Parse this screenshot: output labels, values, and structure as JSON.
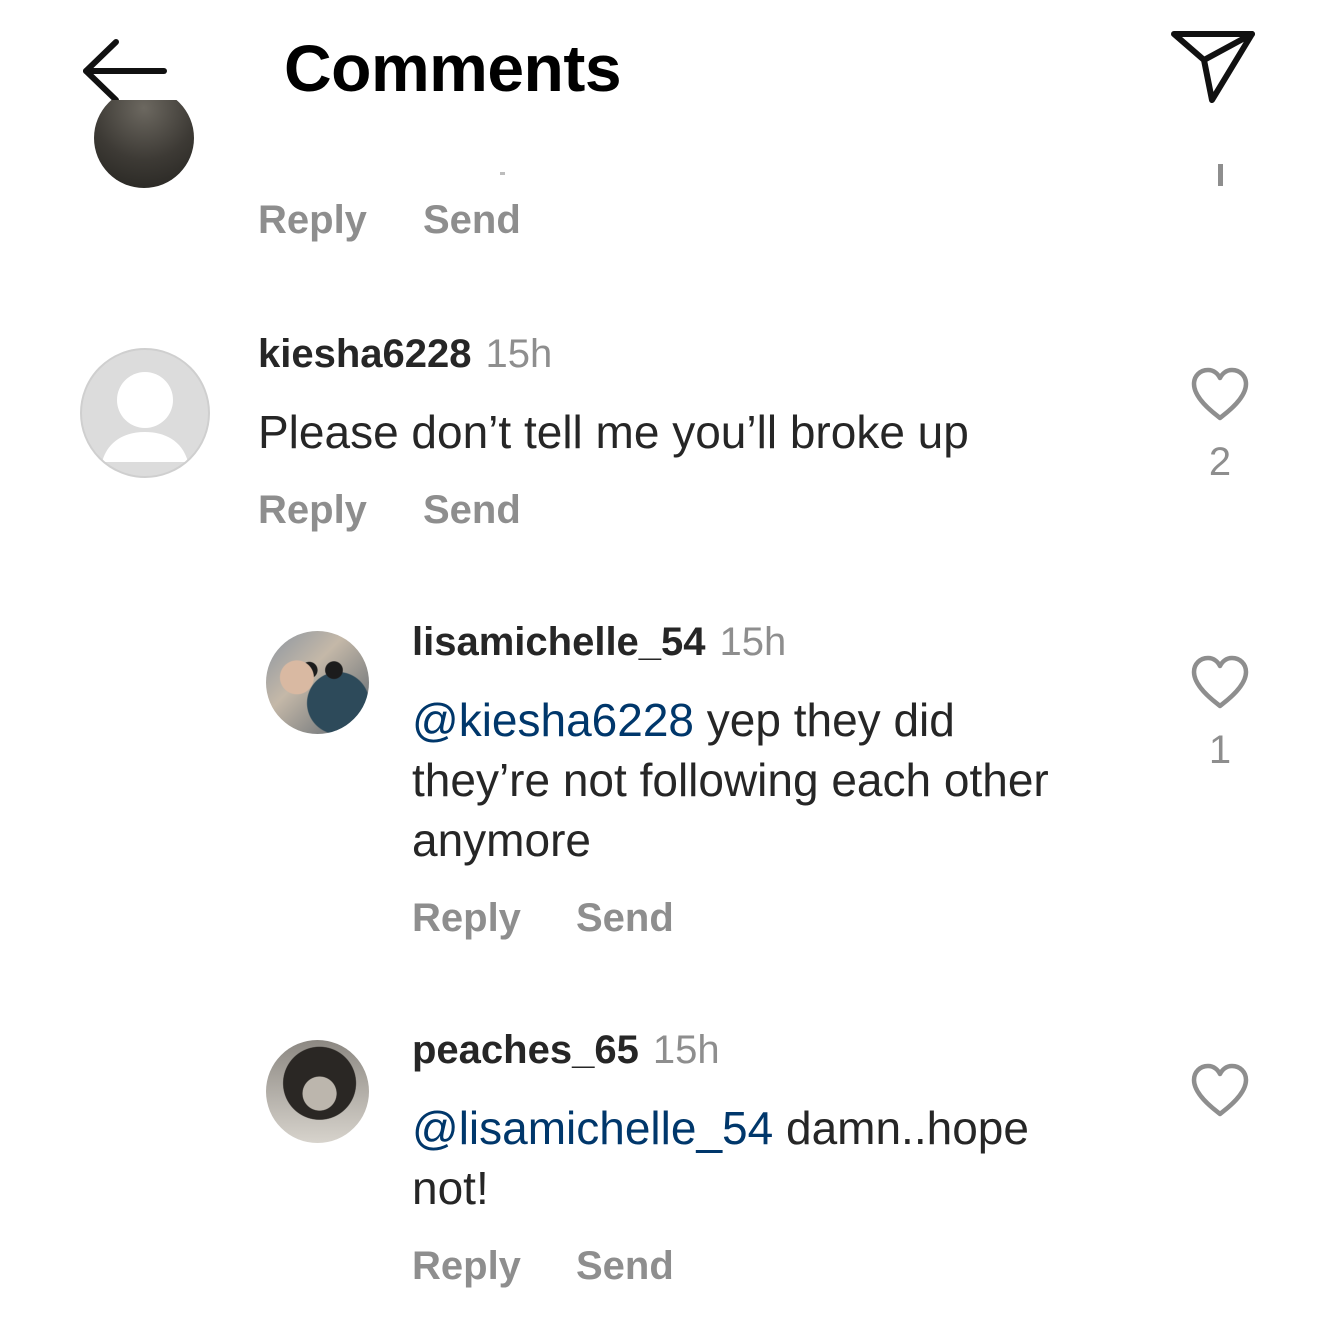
{
  "header": {
    "title": "Comments",
    "back_icon": "arrow-left-icon",
    "share_icon": "paper-plane-icon"
  },
  "colors": {
    "text_primary": "#262626",
    "text_secondary": "#8e8e8e",
    "mention": "#00376b"
  },
  "actions": {
    "reply_label": "Reply",
    "send_label": "Send"
  },
  "comments": [
    {
      "username": "kiesha6228",
      "time": "15h",
      "text": "Please don’t tell me you’ll broke up",
      "likes": "2"
    }
  ],
  "replies": [
    {
      "username": "lisamichelle_54",
      "time": "15h",
      "mention": "@kiesha6228",
      "text_line1": " yep they did",
      "text_line2": "they’re not following each other",
      "text_line3": "anymore",
      "likes": "1"
    },
    {
      "username": "peaches_65",
      "time": "15h",
      "mention": "@lisamichelle_54",
      "text_line1": " damn..hope",
      "text_line2": "not!"
    }
  ]
}
